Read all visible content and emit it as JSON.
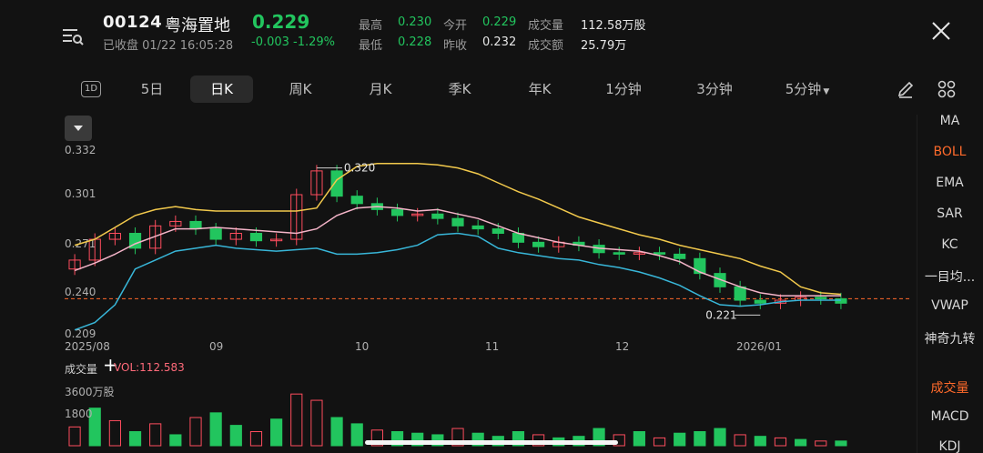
{
  "header": {
    "code": "00124",
    "name": "粤海置地",
    "price": "0.229",
    "status": "已收盘 01/22 16:05:28",
    "change": "-0.003 -1.29%",
    "stats": {
      "high_label": "最高",
      "high": "0.230",
      "open_label": "今开",
      "open": "0.229",
      "volume_label": "成交量",
      "volume": "112.58万股",
      "low_label": "最低",
      "low": "0.228",
      "prev_close_label": "昨收",
      "prev_close": "0.232",
      "amount_label": "成交额",
      "amount": "25.79万"
    }
  },
  "tabs": {
    "d1": "1D",
    "items": [
      "5日",
      "日K",
      "周K",
      "月K",
      "季K",
      "年K",
      "1分钟",
      "3分钟",
      "5分钟"
    ],
    "active": "日K"
  },
  "sidebar": {
    "items": [
      "MA",
      "BOLL",
      "EMA",
      "SAR",
      "KC",
      "一目均...",
      "VWAP",
      "神奇九转",
      "成交量",
      "MACD",
      "KDJ"
    ],
    "active": [
      "BOLL",
      "成交量"
    ]
  },
  "colors": {
    "up": "#ff4d5e",
    "down": "#22c55e",
    "accent": "#ff6a2b",
    "boll_upper": "#f2c94c",
    "boll_mid": "#f4b4c8",
    "boll_lower": "#38b6d8"
  },
  "chart_data": {
    "type": "candlestick",
    "indicator": "BOLL",
    "y_ticks": [
      "0.332",
      "0.301",
      "0.271",
      "0.240",
      "0.209"
    ],
    "ylim": [
      0.209,
      0.332
    ],
    "x_ticks": [
      "2025/08",
      "09",
      "10",
      "11",
      "12",
      "2026/01"
    ],
    "annotations": {
      "high": "0.320",
      "low": "0.221"
    },
    "reference_price": 0.232,
    "boll_upper": [
      0.268,
      0.272,
      0.28,
      0.288,
      0.292,
      0.294,
      0.292,
      0.291,
      0.291,
      0.291,
      0.291,
      0.291,
      0.293,
      0.312,
      0.321,
      0.323,
      0.323,
      0.323,
      0.322,
      0.32,
      0.316,
      0.31,
      0.304,
      0.299,
      0.293,
      0.287,
      0.283,
      0.279,
      0.275,
      0.272,
      0.268,
      0.265,
      0.262,
      0.259,
      0.254,
      0.25,
      0.24,
      0.236,
      0.235
    ],
    "boll_mid": [
      0.251,
      0.256,
      0.262,
      0.269,
      0.274,
      0.279,
      0.279,
      0.28,
      0.279,
      0.278,
      0.277,
      0.276,
      0.279,
      0.288,
      0.293,
      0.294,
      0.293,
      0.291,
      0.292,
      0.289,
      0.286,
      0.281,
      0.276,
      0.273,
      0.27,
      0.268,
      0.266,
      0.265,
      0.264,
      0.261,
      0.257,
      0.25,
      0.245,
      0.24,
      0.236,
      0.234,
      0.234,
      0.234,
      0.234
    ],
    "boll_lower": [
      0.211,
      0.216,
      0.228,
      0.252,
      0.258,
      0.264,
      0.266,
      0.268,
      0.266,
      0.265,
      0.264,
      0.265,
      0.266,
      0.262,
      0.262,
      0.263,
      0.265,
      0.268,
      0.275,
      0.276,
      0.274,
      0.266,
      0.263,
      0.261,
      0.259,
      0.258,
      0.255,
      0.253,
      0.25,
      0.246,
      0.241,
      0.234,
      0.228,
      0.227,
      0.228,
      0.23,
      0.231,
      0.231,
      0.231
    ],
    "closes": [
      0.258,
      0.272,
      0.276,
      0.266,
      0.281,
      0.284,
      0.279,
      0.272,
      0.276,
      0.271,
      0.272,
      0.302,
      0.318,
      0.301,
      0.296,
      0.292,
      0.288,
      0.289,
      0.286,
      0.281,
      0.279,
      0.276,
      0.27,
      0.267,
      0.27,
      0.268,
      0.263,
      0.262,
      0.263,
      0.262,
      0.259,
      0.249,
      0.24,
      0.231,
      0.229,
      0.231,
      0.233,
      0.232,
      0.229
    ],
    "volume": {
      "label": "成交量",
      "value_label": "VOL:112.583",
      "unit": "3600万股",
      "y_ticks": [
        "3600万股",
        "1800"
      ],
      "values_wan": [
        1200,
        2400,
        1600,
        900,
        1400,
        700,
        1800,
        2100,
        1300,
        900,
        1700,
        3300,
        2900,
        1800,
        1400,
        1000,
        900,
        800,
        700,
        1100,
        800,
        600,
        900,
        700,
        500,
        600,
        1100,
        700,
        900,
        500,
        800,
        900,
        1100,
        700,
        600,
        500,
        400,
        300,
        300
      ],
      "up": [
        1,
        0,
        1,
        0,
        1,
        0,
        1,
        0,
        0,
        1,
        0,
        1,
        1,
        0,
        0,
        1,
        0,
        0,
        0,
        1,
        0,
        0,
        0,
        1,
        0,
        0,
        0,
        1,
        0,
        1,
        0,
        0,
        0,
        1,
        0,
        1,
        0,
        1,
        0
      ]
    }
  }
}
